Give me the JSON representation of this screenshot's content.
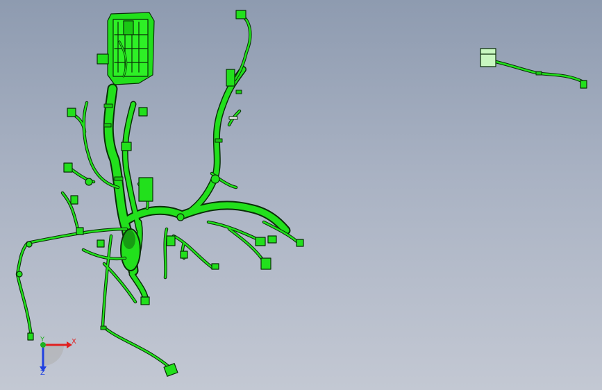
{
  "viewport": {
    "background_top": "#8e9bb0",
    "background_bottom": "#c3c8d3",
    "model_color": "#22e01c",
    "model_outline": "#0a2e08"
  },
  "triad": {
    "x_label": "X",
    "y_label": "Y",
    "z_label": "Z",
    "x_color": "#e02020",
    "y_color": "#20b020",
    "z_color": "#2040e0"
  }
}
